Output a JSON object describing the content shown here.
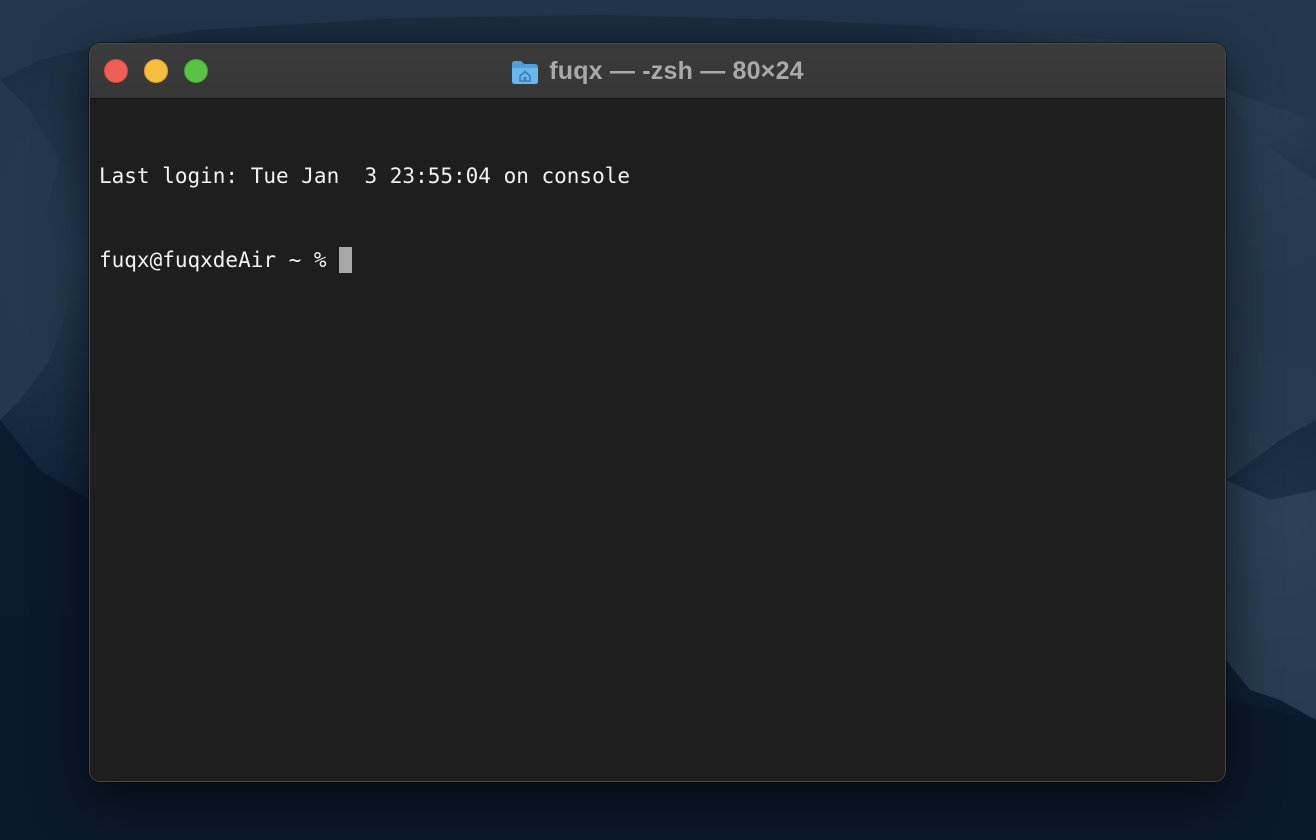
{
  "window": {
    "title": "fuqx — -zsh — 80×24",
    "title_icon": "home-folder-icon",
    "controls": {
      "close_color": "#ee5f58",
      "minimize_color": "#f6bd3f",
      "zoom_color": "#5ac245"
    }
  },
  "terminal": {
    "lines": [
      "Last login: Tue Jan  3 23:55:04 on console"
    ],
    "prompt": "fuqx@fuqxdeAir ~ % ",
    "background": "#1e1e1e",
    "foreground": "#f2f2f2",
    "cursor_color": "#a8a8a8"
  }
}
